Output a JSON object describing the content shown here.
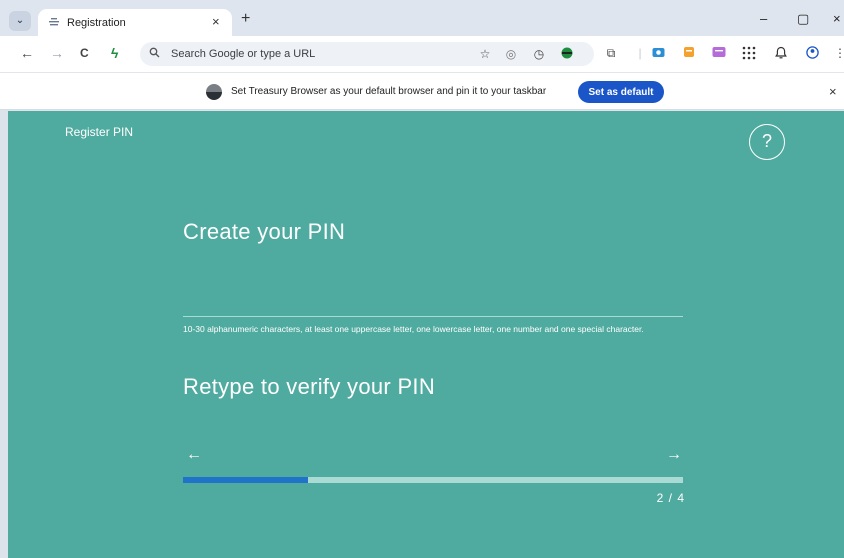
{
  "browser": {
    "tab_title": "Registration",
    "tab_close": "×",
    "new_tab": "+",
    "window_controls": {
      "minimize": "–",
      "maximize": "▢",
      "close": "×"
    },
    "nav": {
      "back": "←",
      "forward": "→",
      "reload": "C",
      "lightning": "ϟ"
    },
    "omnibox_placeholder": "Search Google or type a URL",
    "toolbar_icons": [
      "star-icon",
      "shield-icon",
      "timer-icon",
      "account-icon",
      "extensions-icon",
      "camera-icon",
      "bookmark-icon",
      "media-icon",
      "apps-grid-icon",
      "bell-icon",
      "profile-icon",
      "menu-icon"
    ]
  },
  "infobar": {
    "text": "Set Treasury Browser as your default browser and pin it to your taskbar",
    "button": "Set as default",
    "close": "×"
  },
  "app": {
    "header_title": "Register PIN",
    "help_label": "?",
    "create_label": "Create your PIN",
    "hint": "10-30 alphanumeric characters, at least one uppercase letter, one lowercase letter, one number and one special character.",
    "retype_label": "Retype to verify your PIN",
    "prev_arrow": "←",
    "next_arrow": "→",
    "progress_fraction": 0.25,
    "page_indicator": "2 / 4"
  },
  "colors": {
    "app_background": "#4fab9f",
    "progress_fill": "#1f74c9",
    "progress_track": "#a9dbd4",
    "primary_button": "#1a56c8"
  }
}
